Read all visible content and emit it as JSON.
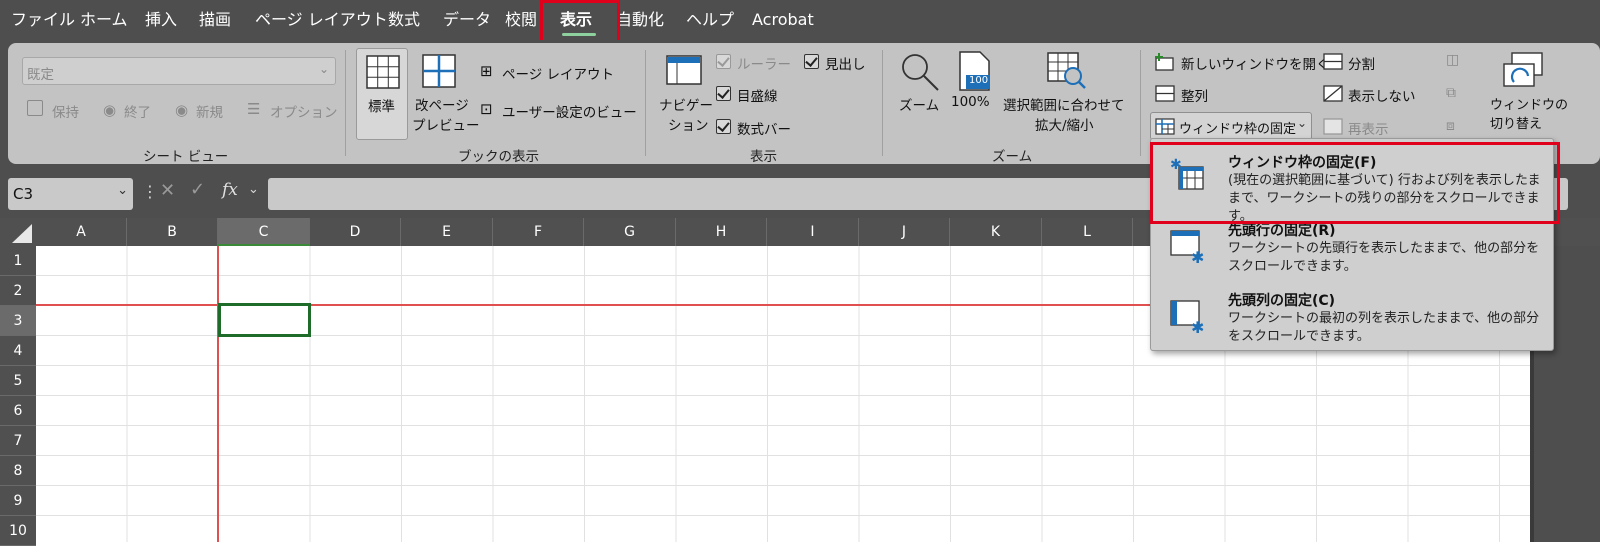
{
  "menu": {
    "items": [
      "ファイル",
      "ホーム",
      "挿入",
      "描画",
      "ページ レイアウト",
      "数式",
      "データ",
      "校閲",
      "表示",
      "自動化",
      "ヘルプ",
      "Acrobat"
    ],
    "active": "表示"
  },
  "ribbon": {
    "sheet_view": {
      "dropdown_value": "既定",
      "keep": "保持",
      "exit": "終了",
      "new": "新規",
      "options": "オプション",
      "label": "シート ビュー"
    },
    "workbook_views": {
      "normal": "標準",
      "page_break_line1": "改ページ",
      "page_break_line2": "プレビュー",
      "page_layout": "ページ レイアウト",
      "custom_views": "ユーザー設定のビュー",
      "label": "ブックの表示"
    },
    "show": {
      "navigation_line1": "ナビゲー",
      "navigation_line2": "ション",
      "ruler": "ルーラー",
      "gridlines": "目盛線",
      "formula_bar": "数式バー",
      "headings": "見出し",
      "label": "表示"
    },
    "zoom": {
      "zoom": "ズーム",
      "hundred": "100%",
      "fit_line1": "選択範囲に合わせて",
      "fit_line2": "拡大/縮小",
      "icon_text": "100",
      "label": "ズーム"
    },
    "window": {
      "new_window": "新しいウィンドウを開く",
      "arrange": "整列",
      "freeze_panes": "ウィンドウ枠の固定",
      "split": "分割",
      "hide": "表示しない",
      "unhide": "再表示",
      "switch_line1": "ウィンドウの",
      "switch_line2": "切り替え"
    }
  },
  "formula_bar": {
    "name_box": "C3",
    "fx": "fx"
  },
  "grid": {
    "columns": [
      "A",
      "B",
      "C",
      "D",
      "E",
      "F",
      "G",
      "H",
      "I",
      "J",
      "K",
      "L"
    ],
    "rows": [
      "1",
      "2",
      "3",
      "4",
      "5",
      "6",
      "7",
      "8",
      "9",
      "10"
    ],
    "selected_cell": "C3"
  },
  "dropdown": {
    "items": [
      {
        "title": "ウィンドウ枠の固定(F)",
        "desc": "(現在の選択範囲に基づいて) 行および列を表示したままで、ワークシートの残りの部分をスクロールできます。"
      },
      {
        "title": "先頭行の固定(R)",
        "desc": "ワークシートの先頭行を表示したままで、他の部分をスクロールできます。"
      },
      {
        "title": "先頭列の固定(C)",
        "desc": "ワークシートの最初の列を表示したままで、他の部分をスクロールできます。"
      }
    ]
  },
  "colors": {
    "highlight_red": "#e0001b",
    "active_cell_green": "#1f6b2a",
    "freeze_line_red": "#e05050",
    "icon_blue": "#1d6fb8"
  }
}
